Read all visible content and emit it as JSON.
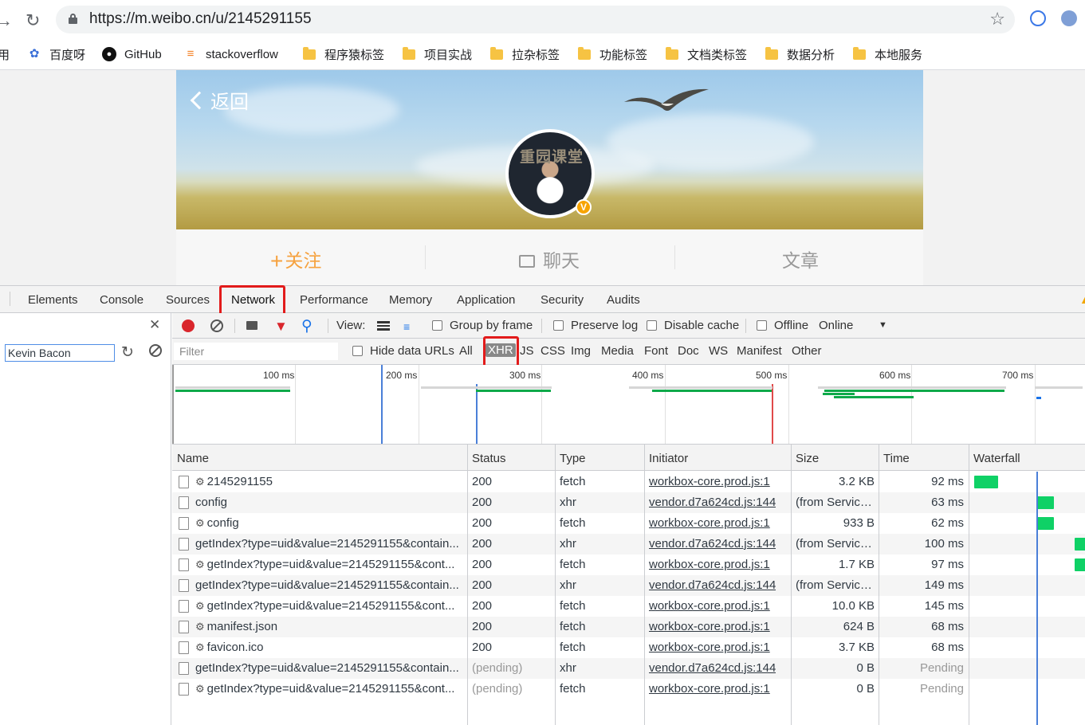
{
  "browser": {
    "url": "https://m.weibo.cn/u/2145291155",
    "bookmarks": [
      {
        "label": "用",
        "icon": "none"
      },
      {
        "label": "百度呀",
        "icon": "baidu-paw-icon"
      },
      {
        "label": "GitHub",
        "icon": "github-icon"
      },
      {
        "label": "stackoverflow",
        "icon": "stackoverflow-icon"
      },
      {
        "label": "程序猿标签",
        "icon": "folder-icon"
      },
      {
        "label": "项目实战",
        "icon": "folder-icon"
      },
      {
        "label": "拉杂标签",
        "icon": "folder-icon"
      },
      {
        "label": "功能标签",
        "icon": "folder-icon"
      },
      {
        "label": "文档类标签",
        "icon": "folder-icon"
      },
      {
        "label": "数据分析",
        "icon": "folder-icon"
      },
      {
        "label": "本地服务",
        "icon": "folder-icon"
      }
    ]
  },
  "page": {
    "back_label": "返回",
    "avatar_text": "重园课堂",
    "verified_mark": "V",
    "actions": {
      "follow": "关注",
      "follow_symbol": "+",
      "chat": "聊天",
      "article": "文章"
    },
    "colors": {
      "follow": "#f6a23f",
      "chat": "#999999",
      "article": "#999999"
    }
  },
  "devtools": {
    "tabs": [
      "Elements",
      "Console",
      "Sources",
      "Network",
      "Performance",
      "Memory",
      "Application",
      "Security",
      "Audits"
    ],
    "active_tab": "Network",
    "search_value": "Kevin Bacon",
    "toolbar": {
      "view_label": "View:",
      "group_by_frame": "Group by frame",
      "preserve_log": "Preserve log",
      "disable_cache": "Disable cache",
      "offline": "Offline",
      "online": "Online"
    },
    "filter": {
      "placeholder": "Filter",
      "hide_data_urls": "Hide data URLs",
      "types": [
        "All",
        "XHR",
        "JS",
        "CSS",
        "Img",
        "Media",
        "Font",
        "Doc",
        "WS",
        "Manifest",
        "Other"
      ],
      "selected": "XHR"
    },
    "overview_ticks": [
      "100 ms",
      "200 ms",
      "300 ms",
      "400 ms",
      "500 ms",
      "600 ms",
      "700 ms"
    ],
    "columns": [
      "Name",
      "Status",
      "Type",
      "Initiator",
      "Size",
      "Time",
      "Waterfall"
    ],
    "rows": [
      {
        "name": "2145291155",
        "sw": true,
        "status": "200",
        "type": "fetch",
        "initiator": "workbox-core.prod.js:1",
        "size": "3.2 KB",
        "time": "92 ms"
      },
      {
        "name": "config",
        "sw": false,
        "status": "200",
        "type": "xhr",
        "initiator": "vendor.d7a624cd.js:144",
        "size": "(from Service...",
        "time": "63 ms"
      },
      {
        "name": "config",
        "sw": true,
        "status": "200",
        "type": "fetch",
        "initiator": "workbox-core.prod.js:1",
        "size": "933 B",
        "time": "62 ms"
      },
      {
        "name": "getIndex?type=uid&value=2145291155&contain...",
        "sw": false,
        "status": "200",
        "type": "xhr",
        "initiator": "vendor.d7a624cd.js:144",
        "size": "(from Service...",
        "time": "100 ms"
      },
      {
        "name": "getIndex?type=uid&value=2145291155&cont...",
        "sw": true,
        "status": "200",
        "type": "fetch",
        "initiator": "workbox-core.prod.js:1",
        "size": "1.7 KB",
        "time": "97 ms"
      },
      {
        "name": "getIndex?type=uid&value=2145291155&contain...",
        "sw": false,
        "status": "200",
        "type": "xhr",
        "initiator": "vendor.d7a624cd.js:144",
        "size": "(from Service...",
        "time": "149 ms"
      },
      {
        "name": "getIndex?type=uid&value=2145291155&cont...",
        "sw": true,
        "status": "200",
        "type": "fetch",
        "initiator": "workbox-core.prod.js:1",
        "size": "10.0 KB",
        "time": "145 ms"
      },
      {
        "name": "manifest.json",
        "sw": true,
        "status": "200",
        "type": "fetch",
        "initiator": "workbox-core.prod.js:1",
        "size": "624 B",
        "time": "68 ms"
      },
      {
        "name": "favicon.ico",
        "sw": true,
        "status": "200",
        "type": "fetch",
        "initiator": "workbox-core.prod.js:1",
        "size": "3.7 KB",
        "time": "68 ms"
      },
      {
        "name": "getIndex?type=uid&value=2145291155&contain...",
        "sw": false,
        "status": "(pending)",
        "type": "xhr",
        "initiator": "vendor.d7a624cd.js:144",
        "size": "0 B",
        "time": "Pending"
      },
      {
        "name": "getIndex?type=uid&value=2145291155&cont...",
        "sw": true,
        "status": "(pending)",
        "type": "fetch",
        "initiator": "workbox-core.prod.js:1",
        "size": "0 B",
        "time": "Pending"
      }
    ],
    "gear_symbol": "⚙"
  }
}
